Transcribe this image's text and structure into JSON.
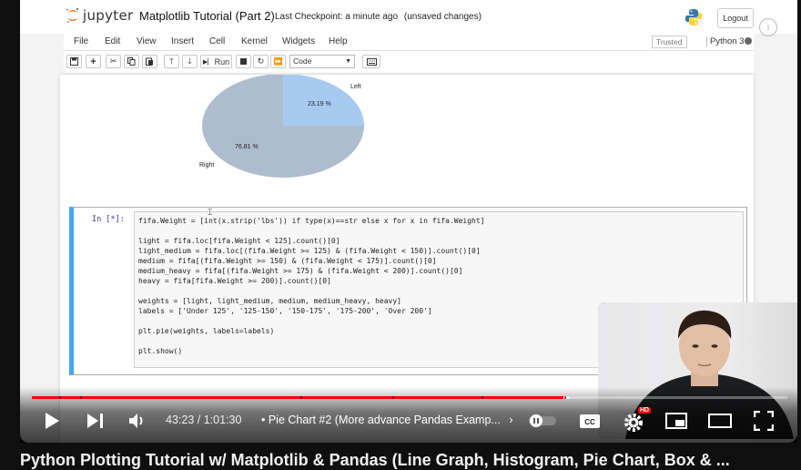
{
  "jupyter": {
    "logo_text": "jupyter",
    "notebook_title": "Matplotlib Tutorial (Part 2)",
    "checkpoint": "Last Checkpoint: a minute ago",
    "unsaved": "(unsaved changes)",
    "logout_label": "Logout",
    "menu": [
      "File",
      "Edit",
      "View",
      "Insert",
      "Cell",
      "Kernel",
      "Widgets",
      "Help"
    ],
    "trusted": "Trusted",
    "kernel": "Python 3",
    "toolbar": {
      "run_label": "Run",
      "cell_type": "Code"
    },
    "pie": {
      "labels": [
        "Left",
        "Right"
      ],
      "pct_labels": [
        "23.19 %",
        "76.81 %"
      ],
      "values": [
        23.19,
        76.81
      ],
      "colors": [
        "#a7cbf0",
        "#aebcd0"
      ]
    },
    "cell": {
      "prompt": "In [*]:",
      "code_lines": [
        "fifa.Weight = [int(x.strip('lbs')) if type(x)==str else x for x in fifa.Weight]",
        "",
        "light = fifa.loc[fifa.Weight < 125].count()[0]",
        "light_medium = fifa.loc[(fifa.Weight >= 125) & (fifa.Weight < 150)].count()[0]",
        "medium = fifa[(fifa.Weight >= 150) & (fifa.Weight < 175)].count()[0]",
        "medium_heavy = fifa[(fifa.Weight >= 175) & (fifa.Weight < 200)].count()[0]",
        "heavy = fifa[fifa.Weight >= 200)].count()[0]",
        "",
        "weights = [light, light_medium, medium, medium_heavy, heavy]",
        "labels = ['Under 125', '125-150', '150-175', '175-200', 'Over 200']",
        "",
        "plt.pie(weights, labels=labels)",
        "",
        "plt.show()"
      ]
    }
  },
  "player": {
    "current_time": "43:23",
    "separator": "/",
    "duration": "1:01:30",
    "chapter": "• Pie Chart #2 (More advance Pandas Examp...",
    "progress": 0.704,
    "buffered": 0.712,
    "hd_badge": "HD",
    "accent": "#ff0000"
  },
  "video_title_below": "Python Plotting Tutorial w/ Matplotlib & Pandas (Line Graph, Histogram, Pie Chart, Box & ..."
}
